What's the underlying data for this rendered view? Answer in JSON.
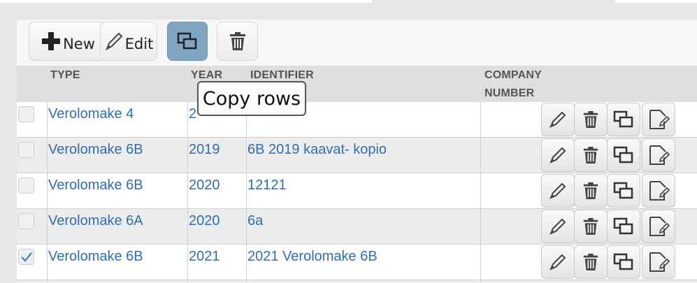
{
  "toolbar": {
    "new_label": "New",
    "edit_label": "Edit"
  },
  "table": {
    "columns": [
      "TYPE",
      "YEAR",
      "IDENTIFIER",
      "COMPANY",
      "NUMBER"
    ],
    "rows": [
      {
        "type": "Verolomake 4",
        "year": "2",
        "identifier": "",
        "company_number": "",
        "checked": false
      },
      {
        "type": "Verolomake 6B",
        "year": "2019",
        "identifier": "6B 2019 kaavat- kopio",
        "company_number": "",
        "checked": false
      },
      {
        "type": "Verolomake 6B",
        "year": "2020",
        "identifier": "12121",
        "company_number": "",
        "checked": false
      },
      {
        "type": "Verolomake 6A",
        "year": "2020",
        "identifier": "6a",
        "company_number": "",
        "checked": false
      },
      {
        "type": "Verolomake 6B",
        "year": "2021",
        "identifier": "2021 Verolomake 6B",
        "company_number": "",
        "checked": true
      }
    ]
  },
  "tooltip": {
    "text": "Copy rows"
  },
  "icons": {
    "new": "plus-icon",
    "edit": "pencil-icon",
    "copy": "copy-rows-icon",
    "delete": "trash-icon",
    "document": "document-icon",
    "check": "checkmark-icon"
  },
  "colors": {
    "link": "#2f6db5",
    "active_button": "#7fa5c2"
  }
}
